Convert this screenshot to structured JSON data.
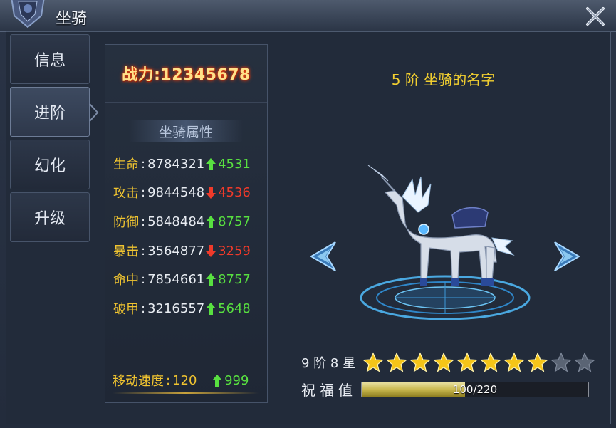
{
  "window": {
    "title": "坐骑"
  },
  "tabs": [
    {
      "label": "信息",
      "active": false
    },
    {
      "label": "进阶",
      "active": true
    },
    {
      "label": "幻化",
      "active": false
    },
    {
      "label": "升级",
      "active": false
    }
  ],
  "power": {
    "text": "战力:12345678"
  },
  "attributes": {
    "title": "坐骑属性",
    "rows": [
      {
        "label": "生命",
        "value": "8784321",
        "delta": "4531",
        "dir": "up"
      },
      {
        "label": "攻击",
        "value": "9844548",
        "delta": "4536",
        "dir": "down"
      },
      {
        "label": "防御",
        "value": "5848484",
        "delta": "8757",
        "dir": "up"
      },
      {
        "label": "暴击",
        "value": "3564877",
        "delta": "3259",
        "dir": "down"
      },
      {
        "label": "命中",
        "value": "7854661",
        "delta": "8757",
        "dir": "up"
      },
      {
        "label": "破甲",
        "value": "3216557",
        "delta": "5648",
        "dir": "up"
      }
    ],
    "speed": {
      "label": "移动速度",
      "value": "120",
      "delta": "999",
      "dir": "up"
    }
  },
  "mount": {
    "name": "5 阶  坐骑的名字"
  },
  "stars": {
    "label": "9 阶 8 星",
    "filled": 8,
    "total": 10
  },
  "bless": {
    "label": "祝福值",
    "text": "100/220",
    "current": 100,
    "max": 220
  },
  "colors": {
    "gold": "#f3d030",
    "up": "#58e040",
    "down": "#f03a2a",
    "star": "#f5c518"
  },
  "icons": {
    "close": "close-icon",
    "prev": "arrow-left-icon",
    "next": "arrow-right-icon",
    "up": "arrow-up-icon",
    "down": "arrow-down-icon",
    "star": "star-icon"
  }
}
